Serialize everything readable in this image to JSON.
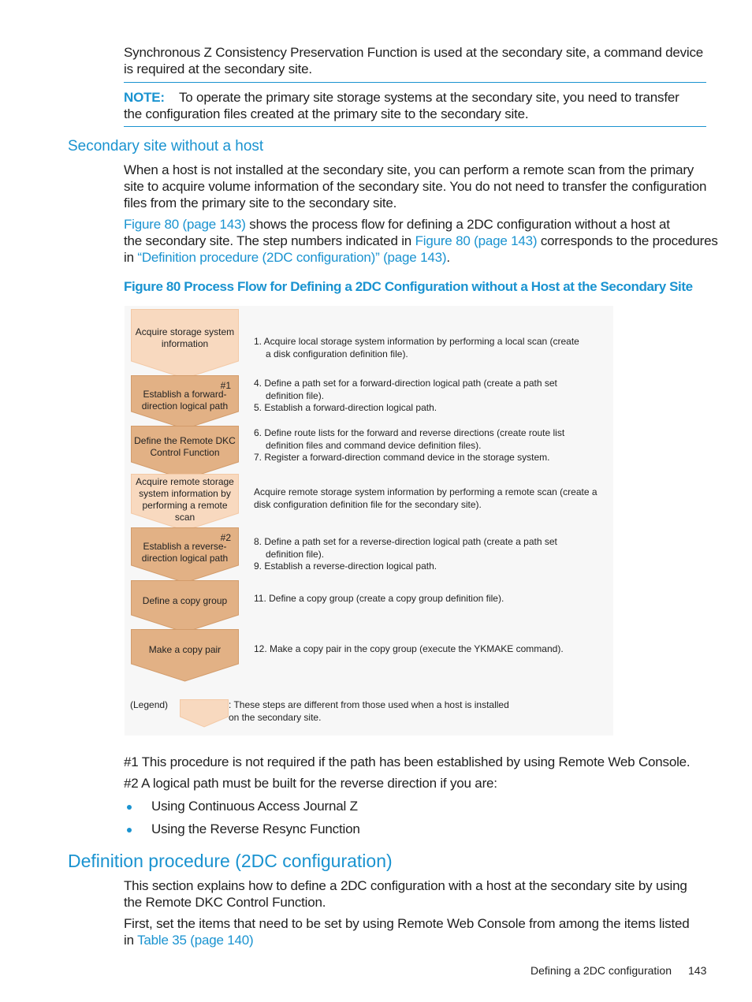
{
  "intro": {
    "line1": "Synchronous Z Consistency Preservation Function is used at the secondary site, a command device",
    "line2": "is required at the secondary site."
  },
  "note": {
    "label": "NOTE:",
    "line1": "To operate the primary site storage systems at the secondary site, you need to transfer",
    "line2": "the configuration files created at the primary site to the secondary site."
  },
  "section_secondary": {
    "heading": "Secondary site without a host",
    "para1": [
      "When a host is not installed at the secondary site, you can perform a remote scan from the primary",
      "site to acquire volume information of the secondary site. You do not need to transfer the configuration",
      "files from the primary site to the secondary site."
    ],
    "para2": {
      "link1": "Figure 80 (page 143)",
      "text1": " shows the process flow for defining a 2DC configuration without a host at",
      "text2": "the secondary site. The step numbers indicated in ",
      "link2": "Figure 80 (page 143)",
      "text3": " corresponds to the procedures",
      "text4": "in ",
      "link3": "“Definition procedure (2DC configuration)” (page 143)",
      "text5": "."
    }
  },
  "figure": {
    "caption": "Figure 80 Process Flow for Defining a 2DC Configuration without a Host at the Secondary Site",
    "colors": {
      "light": "#f8d9bf",
      "dark": "#e2b185",
      "light_border": "#f3c9a6",
      "dark_border": "#d39c6b"
    },
    "steps": [
      {
        "label": [
          "Acquire storage system",
          "information"
        ],
        "style": "light",
        "mark": "",
        "desc": [
          "1. Acquire local storage system information by performing a local scan (create",
          "   a disk configuration definition file)."
        ]
      },
      {
        "label": [
          "Establish a forward-",
          "direction logical path"
        ],
        "style": "dark",
        "mark": "#1",
        "desc": [
          "4. Define a path set for a forward-direction logical path (create a path set",
          "   definition file).",
          "5. Establish a forward-direction logical path."
        ]
      },
      {
        "label": [
          "Define the Remote DKC",
          "Control Function"
        ],
        "style": "dark",
        "mark": "",
        "desc": [
          "6. Define route lists for the forward and reverse directions (create route list",
          "   definition files and command device definition files).",
          "7. Register a forward-direction command device in the storage system."
        ]
      },
      {
        "label": [
          "Acquire remote storage",
          "system information by",
          "performing a remote",
          "scan"
        ],
        "style": "light",
        "mark": "",
        "desc": [
          "Acquire remote storage system information by performing a remote scan (create a",
          "disk configuration definition file for the secondary site)."
        ]
      },
      {
        "label": [
          "Establish a reverse-",
          "direction logical path"
        ],
        "style": "dark",
        "mark": "#2",
        "desc": [
          "8. Define a path set for a reverse-direction logical path (create a path set",
          "   definition file).",
          "9. Establish a reverse-direction logical path."
        ]
      },
      {
        "label": [
          "Define a copy group"
        ],
        "style": "dark",
        "mark": "",
        "desc": [
          "11. Define a copy group (create a copy group definition file)."
        ]
      },
      {
        "label": [
          "Make a copy pair"
        ],
        "style": "dark",
        "mark": "",
        "desc": [
          "12. Make a copy pair in the copy group (execute the YKMAKE command)."
        ]
      }
    ],
    "legend": {
      "label": "(Legend)",
      "line1": ": These steps are different from those used when a host is installed",
      "line2": "on the secondary site."
    }
  },
  "footnotes": {
    "fn1": "#1 This procedure is not required if the path has been established by using Remote Web Console.",
    "fn2": "#2 A logical path must be built for the reverse direction if you are:",
    "bullets": [
      "Using Continuous Access Journal Z",
      "Using the Reverse Resync Function"
    ]
  },
  "section_definition": {
    "heading": "Definition procedure (2DC configuration)",
    "para1": [
      "This section explains how to define a 2DC configuration with a host at the secondary site by using",
      "the Remote DKC Control Function."
    ],
    "para2_line1": "First, set the items that need to be set by using Remote Web Console from among the items listed",
    "para2_prefix": "in ",
    "para2_link": "Table 35 (page 140)"
  },
  "footer": {
    "section": "Defining a 2DC configuration",
    "page": "143"
  }
}
